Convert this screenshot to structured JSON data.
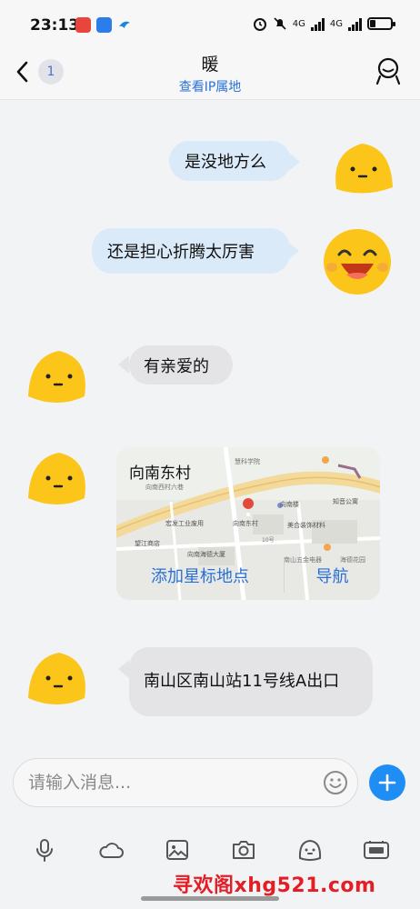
{
  "status_bar": {
    "time": "23:13",
    "net1": "4G",
    "net2": "4G"
  },
  "header": {
    "unread_badge": "1",
    "title": "暖",
    "subtitle": "查看IP属地"
  },
  "messages": [
    {
      "side": "right",
      "text": "是没地方么"
    },
    {
      "side": "right",
      "text": "还是担心折腾太厉害"
    },
    {
      "side": "left",
      "text": "有亲爱的"
    },
    {
      "side": "left",
      "type": "location"
    },
    {
      "side": "left",
      "text": "南山区南山站11号线A出口"
    }
  ],
  "location_card": {
    "title": "向南东村",
    "star_action": "添加星标地点",
    "nav_action": "导航",
    "map_labels": [
      "慧科学院",
      "向南西村六巷",
      "向南楼",
      "知音公寓",
      "宏发工业废用",
      "向南东村",
      "美合装饰材料",
      "望江商店",
      "向南海德大厦",
      "10号",
      "南山五金电器",
      "海德花园"
    ]
  },
  "input": {
    "placeholder": "请输入消息..."
  },
  "toolbar": [
    "mic-icon",
    "cloud-icon",
    "image-icon",
    "camera-icon",
    "emoji-icon",
    "gif-icon"
  ],
  "watermark": "寻欢阁xhg521.com",
  "colors": {
    "accent": "#1e8ef5",
    "link": "#2a73d8",
    "bubble_sent": "#dbeaf8",
    "bubble_received": "#e4e4e6",
    "avatar": "#fbc51a"
  }
}
